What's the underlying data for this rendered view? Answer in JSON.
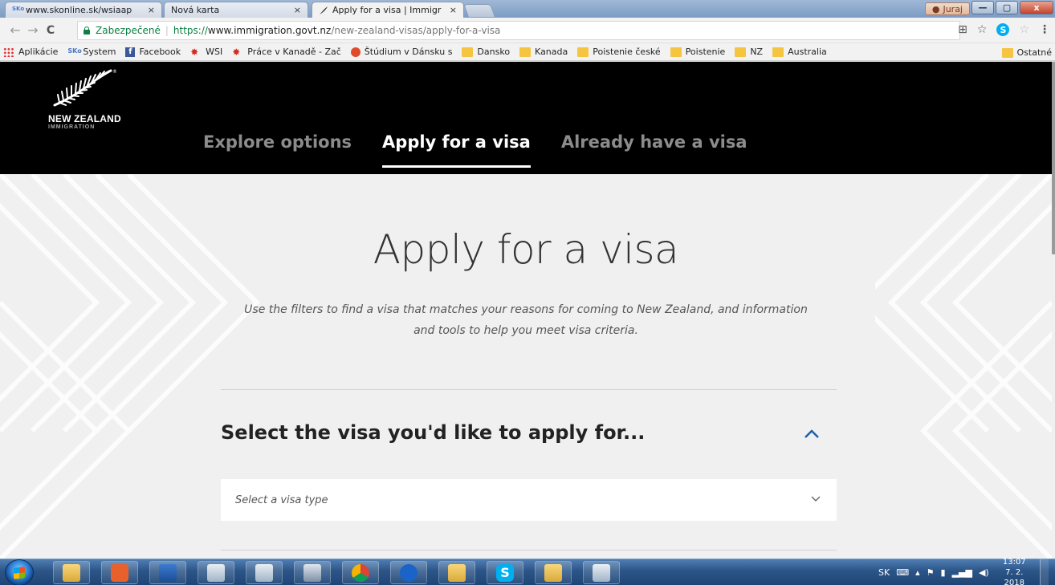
{
  "browser": {
    "tabs": [
      {
        "title": "www.skonline.sk/wsiaap",
        "favicon": "sko-icon",
        "active": false
      },
      {
        "title": "Nová karta",
        "favicon": "",
        "active": false
      },
      {
        "title": "Apply for a visa | Immigr",
        "favicon": "fern-icon",
        "active": true
      }
    ],
    "close_glyph": "×",
    "profile_name": "Juraj",
    "window_buttons": {
      "minimize": "—",
      "maximize": "▢",
      "close": "x"
    },
    "secure_label": "Zabezpečené",
    "omni_separator": "|",
    "url": {
      "scheme": "https://",
      "host": "www.immigration.govt.nz",
      "path": "/new-zealand-visas/apply-for-a-visa"
    },
    "nav_glyphs": {
      "back": "←",
      "forward": "→",
      "reload": "C"
    },
    "toolbar_glyphs": {
      "translate": "⊞",
      "star": "☆",
      "skype": "S",
      "ext": "☆",
      "menu": "⋮"
    },
    "bookmarks": [
      {
        "label": "Aplikácie",
        "icon": "apps-icon"
      },
      {
        "label": "System",
        "icon": "sko-icon"
      },
      {
        "label": "Facebook",
        "icon": "facebook-icon"
      },
      {
        "label": "WSI",
        "icon": "maple-leaf-icon"
      },
      {
        "label": "Práce v Kanadě - Zač",
        "icon": "maple-leaf-icon"
      },
      {
        "label": "Štúdium v Dánsku s",
        "icon": "globe-icon"
      },
      {
        "label": "Dansko",
        "icon": "folder-icon"
      },
      {
        "label": "Kanada",
        "icon": "folder-icon"
      },
      {
        "label": "Poistenie české",
        "icon": "folder-icon"
      },
      {
        "label": "Poistenie",
        "icon": "folder-icon"
      },
      {
        "label": "NZ",
        "icon": "folder-icon"
      },
      {
        "label": "Australia",
        "icon": "folder-icon"
      }
    ],
    "other_bookmarks": "Ostatné"
  },
  "site": {
    "logo": {
      "name": "NEW ZEALAND",
      "sub": "IMMIGRATION",
      "registered": "®"
    },
    "nav": [
      {
        "label": "Explore options",
        "active": false
      },
      {
        "label": "Apply for a visa",
        "active": true
      },
      {
        "label": "Already have a visa",
        "active": false
      }
    ],
    "hero": {
      "title": "Apply for a visa",
      "subtitle": "Use the filters to find a visa that matches your reasons for coming to New Zealand, and information and tools to help you meet visa criteria."
    },
    "section": {
      "title": "Select the visa you'd like to apply for...",
      "select_placeholder": "Select a visa type"
    }
  },
  "taskbar": {
    "language": "SK",
    "time": "13:07",
    "date": "7. 2. 2018",
    "skype_letter": "S"
  },
  "colors": {
    "header_bg": "#000000",
    "page_bg": "#f0f0f0",
    "nav_inactive": "#8c8c8c",
    "secure_green": "#0b8043",
    "accent_blue": "#1e5fa8"
  }
}
